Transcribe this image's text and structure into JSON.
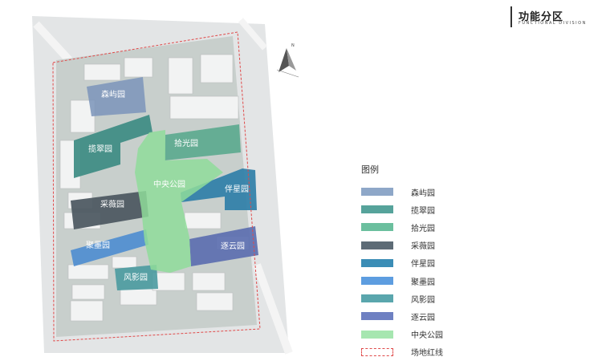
{
  "header": {
    "title": "功能分区",
    "subtitle": "FUNCTIONAL DIVISION"
  },
  "compass": {
    "north": "N"
  },
  "zones": [
    {
      "id": "senyu",
      "label": "森屿园",
      "color": "#7d96bb"
    },
    {
      "id": "lancui",
      "label": "揽翠园",
      "color": "#3d8c83"
    },
    {
      "id": "shiguang",
      "label": "拾光园",
      "color": "#5aa88e"
    },
    {
      "id": "caiwei",
      "label": "采薇园",
      "color": "#4b5760"
    },
    {
      "id": "banxing",
      "label": "伴星园",
      "color": "#2f7fa8"
    },
    {
      "id": "jumo",
      "label": "聚墨园",
      "color": "#4f8ed0"
    },
    {
      "id": "fengying",
      "label": "风影园",
      "color": "#4a9aa0"
    },
    {
      "id": "zhuyun",
      "label": "逐云园",
      "color": "#5c6fb0"
    },
    {
      "id": "park",
      "label": "中央公园",
      "color": "#8fdc9a"
    }
  ],
  "legend": {
    "title": "图例",
    "items": [
      {
        "label": "森屿园",
        "color": "#8ea7c8"
      },
      {
        "label": "揽翠园",
        "color": "#56a39b"
      },
      {
        "label": "拾光园",
        "color": "#6bbf9e"
      },
      {
        "label": "采薇园",
        "color": "#5d6b76"
      },
      {
        "label": "伴星园",
        "color": "#3b8db6"
      },
      {
        "label": "聚墨园",
        "color": "#5d9de0"
      },
      {
        "label": "风影园",
        "color": "#5aa6ad"
      },
      {
        "label": "逐云园",
        "color": "#6e80c2"
      },
      {
        "label": "中央公园",
        "color": "#a6e6b0"
      },
      {
        "label": "场地红线",
        "color": "#e04a4a",
        "dashed": true
      }
    ]
  }
}
